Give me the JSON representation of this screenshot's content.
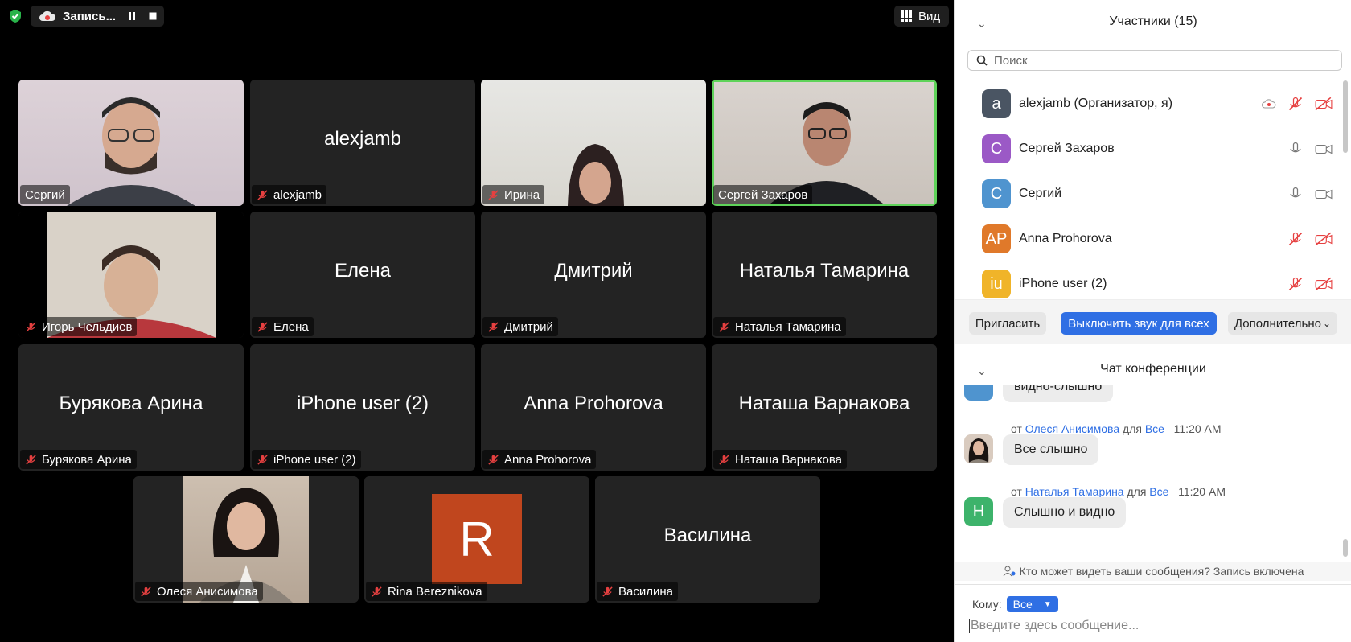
{
  "topbar": {
    "record_label": "Запись...",
    "view_label": "Вид"
  },
  "colors": {
    "accent_blue": "#2f6fe4",
    "active_border": "#5fd35a",
    "mute_red": "#e64040",
    "tile_bg": "#232323"
  },
  "tiles": [
    {
      "big": "",
      "label": "Сергий",
      "muted": false,
      "video": true
    },
    {
      "big": "alexjamb",
      "label": "alexjamb",
      "muted": true,
      "video": false
    },
    {
      "big": "",
      "label": "Ирина",
      "muted": true,
      "video": true
    },
    {
      "big": "",
      "label": "Сергей Захаров",
      "muted": false,
      "video": true,
      "active": true
    },
    {
      "big": "",
      "label": "Игорь Чельдиев",
      "muted": true,
      "video": true
    },
    {
      "big": "Елена",
      "label": "Елена",
      "muted": true,
      "video": false
    },
    {
      "big": "Дмитрий",
      "label": "Дмитрий",
      "muted": true,
      "video": false
    },
    {
      "big": "Наталья Тамарина",
      "label": "Наталья Тамарина",
      "muted": true,
      "video": false
    },
    {
      "big": "Бурякова Арина",
      "label": "Бурякова Арина",
      "muted": true,
      "video": false
    },
    {
      "big": "iPhone user (2)",
      "label": "iPhone user (2)",
      "muted": true,
      "video": false
    },
    {
      "big": "Anna Prohorova",
      "label": "Anna Prohorova",
      "muted": true,
      "video": false
    },
    {
      "big": "Наташа Варнакова",
      "label": "Наташа Варнакова",
      "muted": true,
      "video": false
    },
    {
      "big": "",
      "label": "Олеся Анисимова",
      "muted": true,
      "video": true
    },
    {
      "big": "R",
      "label": "Rina Bereznikova",
      "muted": true,
      "video": false
    },
    {
      "big": "Василина",
      "label": "Василина",
      "muted": true,
      "video": false
    }
  ],
  "participants": {
    "title": "Участники (15)",
    "search_placeholder": "Поиск",
    "list": [
      {
        "initials": "a",
        "name": "alexjamb (Организатор, я)",
        "avatar_color": "#4a5563",
        "muted": true,
        "cam_off": true,
        "recording": true
      },
      {
        "initials": "С",
        "name": "Сергей Захаров",
        "avatar_color": "#9b59c6",
        "muted": false,
        "cam_off": false
      },
      {
        "initials": "С",
        "name": "Сергий",
        "avatar_color": "#4f94cf",
        "muted": false,
        "cam_off": false
      },
      {
        "initials": "AP",
        "name": "Anna Prohorova",
        "avatar_color": "#e0792a",
        "muted": true,
        "cam_off": true
      },
      {
        "initials": "iu",
        "name": "iPhone user (2)",
        "avatar_color": "#f0b429",
        "muted": true,
        "cam_off": true
      }
    ],
    "invite": "Пригласить",
    "mute_all": "Выключить звук для всех",
    "more": "Дополнительно"
  },
  "chat": {
    "title": "Чат конференции",
    "partial_message": "видно-слышно",
    "messages": [
      {
        "from_prefix": "от",
        "sender": "Олеся Анисимова",
        "to_prefix": "для",
        "recipient": "Все",
        "time": "11:20 AM",
        "text": "Все слышно",
        "avatar_initial": ""
      },
      {
        "from_prefix": "от",
        "sender": "Наталья Тамарина",
        "to_prefix": "для",
        "recipient": "Все",
        "time": "11:20 AM",
        "text": "Слышно и видно",
        "avatar_initial": "Н"
      }
    ],
    "notice": "Кто может видеть ваши сообщения? Запись включена",
    "to_label": "Кому:",
    "to_value": "Все",
    "input_placeholder": "Введите здесь сообщение..."
  }
}
